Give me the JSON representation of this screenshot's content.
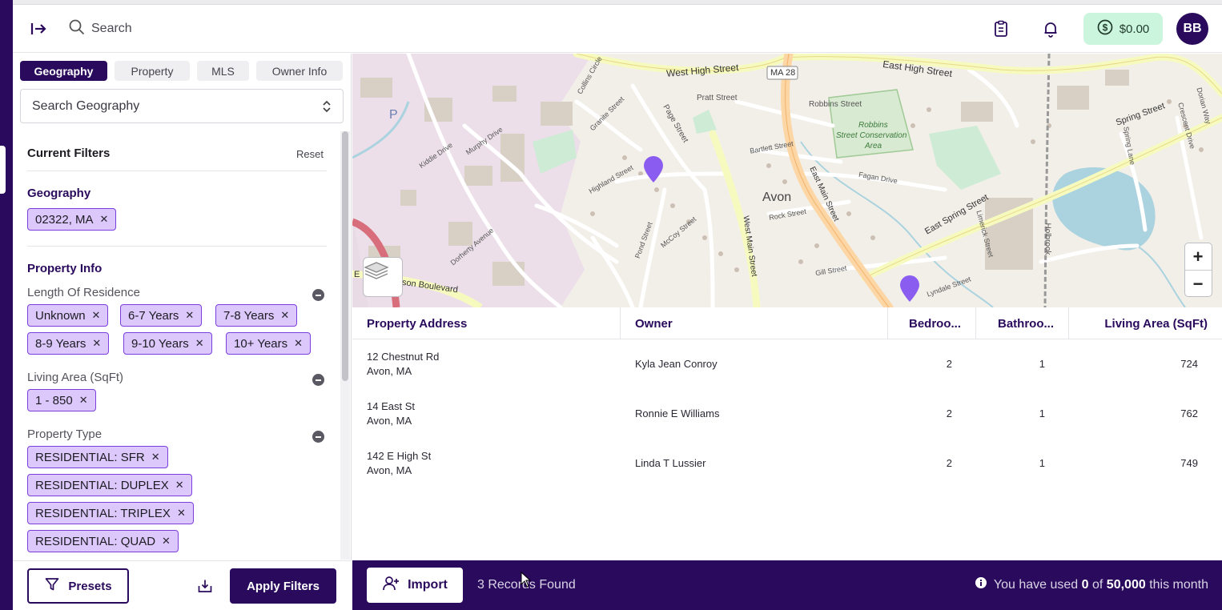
{
  "header": {
    "search_placeholder": "Search",
    "balance": "$0.00",
    "avatar_initials": "BB"
  },
  "sidebar": {
    "tabs": [
      {
        "label": "Geography",
        "active": true
      },
      {
        "label": "Property",
        "active": false
      },
      {
        "label": "MLS",
        "active": false
      },
      {
        "label": "Owner Info",
        "active": false
      }
    ],
    "geo_search_placeholder": "Search Geography",
    "current_filters_title": "Current Filters",
    "reset_label": "Reset",
    "geography": {
      "title": "Geography",
      "chips": [
        "02322, MA"
      ]
    },
    "property_info": {
      "title": "Property Info",
      "length_of_residence": {
        "label": "Length Of Residence",
        "chips": [
          "Unknown",
          "6-7 Years",
          "7-8 Years",
          "8-9 Years",
          "9-10 Years",
          "10+ Years"
        ]
      },
      "living_area": {
        "label": "Living Area (SqFt)",
        "chips": [
          "1 - 850"
        ]
      },
      "property_type": {
        "label": "Property Type",
        "chips": [
          "RESIDENTIAL: SFR",
          "RESIDENTIAL: DUPLEX",
          "RESIDENTIAL: TRIPLEX",
          "RESIDENTIAL: QUAD"
        ]
      }
    },
    "footer": {
      "presets_label": "Presets",
      "apply_label": "Apply Filters"
    }
  },
  "map": {
    "labels": {
      "west_high_street": "West High Street",
      "east_high_street": "East High Street",
      "ma28": "MA 28",
      "pratt_street": "Pratt Street",
      "robbins_street": "Robbins Street",
      "conservation_1": "Robbins",
      "conservation_2": "Street Conservation",
      "conservation_3": "Area",
      "spring_street": "Spring Street",
      "east_spring_street": "East Spring Street",
      "avon": "Avon",
      "east_main_street": "East Main Street",
      "west_main_street": "West Main Street",
      "page_street": "Page Street",
      "highland_street": "Highland Street",
      "murphy_drive": "Murphy Drive",
      "kiddie_drive": "Kiddie Drive",
      "collins_circle": "Collins Circle",
      "granite_street": "Granite Street",
      "bartlett_street": "Bartlett Street",
      "fagan_drive": "Fagan Drive",
      "rock_street": "Rock Street",
      "pond_street": "Pond Street",
      "mccoy_street": "McCoy Street",
      "dorherty_avenue": "Dorherty Avenue",
      "harrison_boulevard": "Harrison Boulevard",
      "holbrook": "Holbrook",
      "spring_lane": "Spring Lane",
      "crescent_drive": "Crescent Drive",
      "dorian_way": "Dorian Way",
      "limerick_street": "Limerick Street",
      "gill_street": "Gill Street",
      "lyndale_street": "Lyndale Street",
      "parking_p": "P",
      "harrison_prefix": "E"
    },
    "zoom_in": "+",
    "zoom_out": "−"
  },
  "table": {
    "columns": [
      "Property Address",
      "Owner",
      "Bedroo...",
      "Bathroo...",
      "Living Area (SqFt)"
    ],
    "rows": [
      {
        "address_line1": "12 Chestnut Rd",
        "address_line2": "Avon, MA",
        "owner": "Kyla Jean Conroy",
        "bedrooms": "2",
        "bathrooms": "1",
        "living_area": "724"
      },
      {
        "address_line1": "14 East St",
        "address_line2": "Avon, MA",
        "owner": "Ronnie E Williams",
        "bedrooms": "2",
        "bathrooms": "1",
        "living_area": "762"
      },
      {
        "address_line1": "142 E High St",
        "address_line2": "Avon, MA",
        "owner": "Linda T Lussier",
        "bedrooms": "2",
        "bathrooms": "1",
        "living_area": "749"
      }
    ]
  },
  "bottom_bar": {
    "import_label": "Import",
    "records_found": "3 Records Found",
    "usage_prefix": "You have used",
    "usage_used": "0",
    "usage_of": "of",
    "usage_limit": "50,000",
    "usage_suffix": "this month"
  },
  "colors": {
    "brand": "#2a0a5c",
    "chip_bg": "#dcc8fb",
    "chip_border": "#7b3fe0",
    "wallet_bg": "#cbf5dc",
    "pin": "#8a5cf0"
  }
}
